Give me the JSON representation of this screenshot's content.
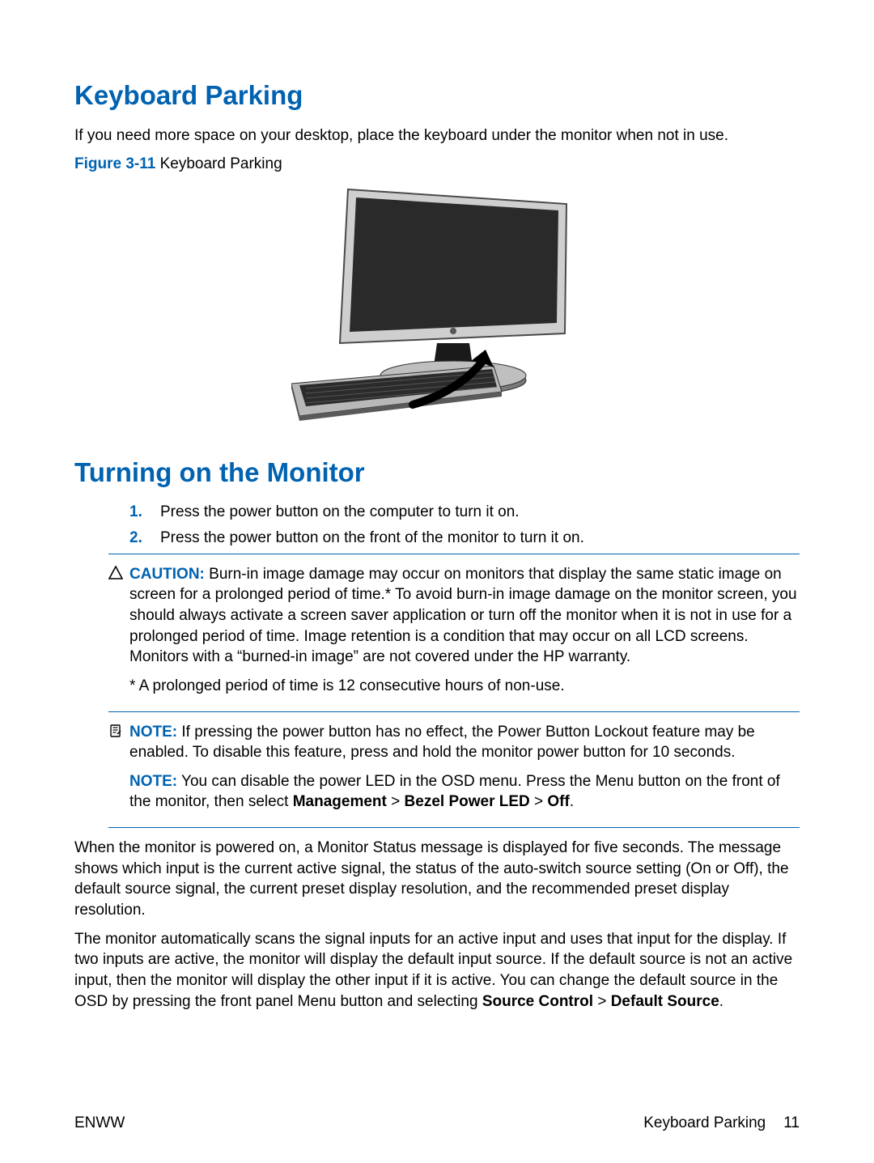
{
  "section1": {
    "heading": "Keyboard Parking",
    "intro": "If you need more space on your desktop, place the keyboard under the monitor when not in use.",
    "figure_label": "Figure 3-11",
    "figure_title": "  Keyboard Parking"
  },
  "section2": {
    "heading": "Turning on the Monitor",
    "steps": [
      "Press the power button on the computer to turn it on.",
      "Press the power button on the front of the monitor to turn it on."
    ],
    "caution_label": "CAUTION:",
    "caution_body": "   Burn-in image damage may occur on monitors that display the same static image on screen for a prolonged period of time.* To avoid burn-in image damage on the monitor screen, you should always activate a screen saver application or turn off the monitor when it is not in use for a prolonged period of time. Image retention is a condition that may occur on all LCD screens. Monitors with a “burned-in image” are not covered under the HP warranty.",
    "caution_star": "* A prolonged period of time is 12 consecutive hours of non-use.",
    "note1_label": "NOTE:",
    "note1_body": "   If pressing the power button has no effect, the Power Button Lockout feature may be enabled. To disable this feature, press and hold the monitor power button for 10 seconds.",
    "note2_label": "NOTE:",
    "note2_body_a": "   You can disable the power LED in the OSD menu. Press the Menu button on the front of the monitor, then select ",
    "note2_body_b": "Management",
    "note2_body_c": " > ",
    "note2_body_d": "Bezel Power LED",
    "note2_body_e": " > ",
    "note2_body_f": "Off",
    "note2_body_g": ".",
    "para1": "When the monitor is powered on, a Monitor Status message is displayed for five seconds. The message shows which input is the current active signal, the status of the auto-switch source setting (On or Off), the default source signal, the current preset display resolution, and the recommended preset display resolution.",
    "para2_a": "The monitor automatically scans the signal inputs for an active input and uses that input for the display. If two inputs are active, the monitor will display the default input source. If the default source is not an active input, then the monitor will display the other input if it is active. You can change the default source in the OSD by pressing the front panel Menu button and selecting ",
    "para2_b": "Source Control",
    "para2_c": " > ",
    "para2_d": "Default Source",
    "para2_e": "."
  },
  "footer": {
    "left": "ENWW",
    "right_label": "Keyboard Parking",
    "page": "11"
  }
}
